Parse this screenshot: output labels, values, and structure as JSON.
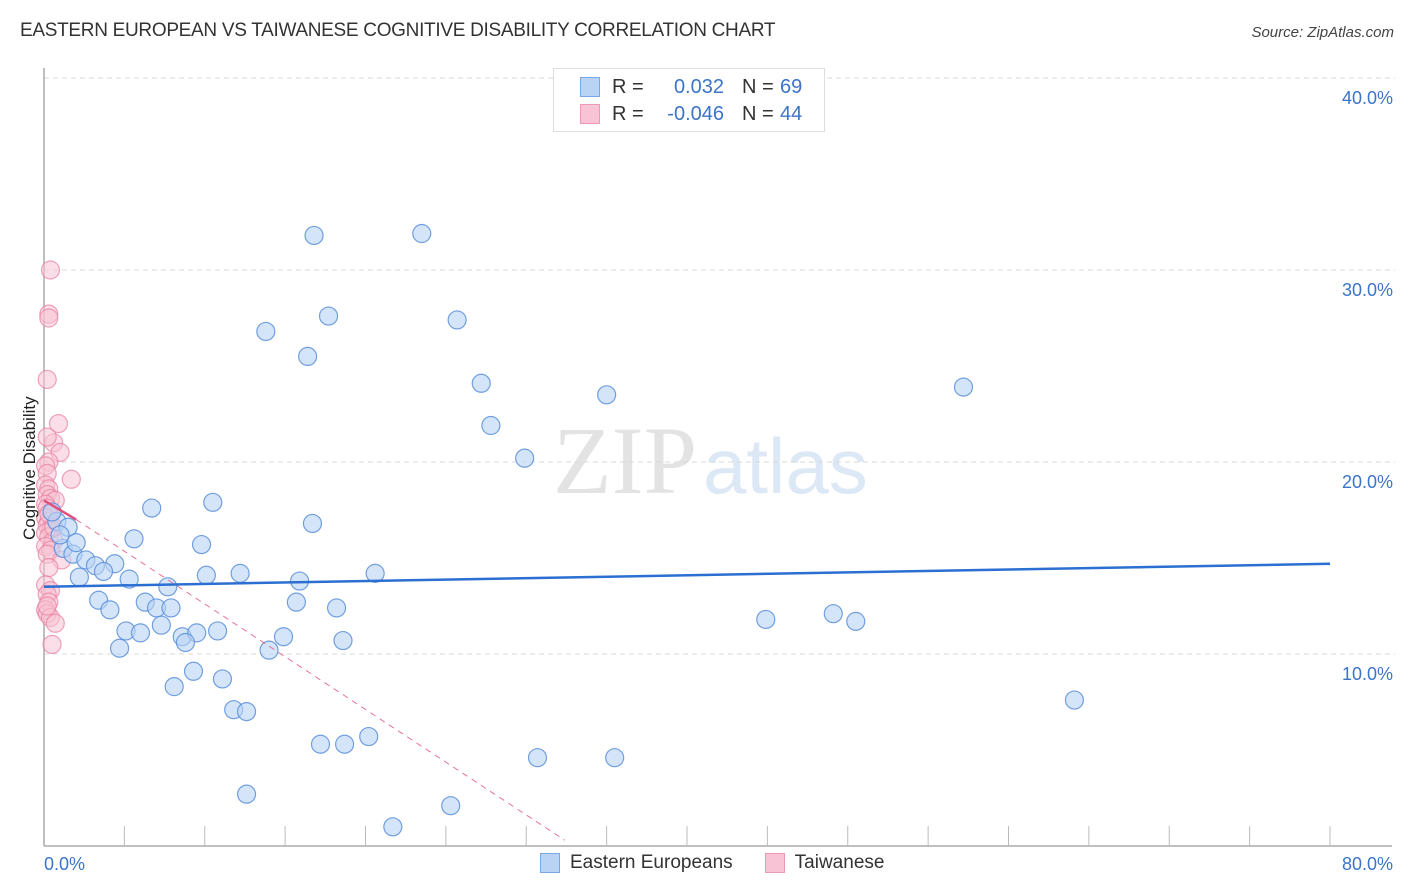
{
  "title": "EASTERN EUROPEAN VS TAIWANESE COGNITIVE DISABILITY CORRELATION CHART",
  "source": "Source: ZipAtlas.com",
  "watermark": {
    "zip": "ZIP",
    "atlas": "atlas"
  },
  "legend_stats": [
    {
      "r_label": "R =",
      "r_value": "0.032",
      "n_label": "N =",
      "n_value": "69"
    },
    {
      "r_label": "R =",
      "r_value": "-0.046",
      "n_label": "N =",
      "n_value": "44"
    }
  ],
  "colors": {
    "blue_fill": "#b9d3f5",
    "blue_stroke": "#5b8fdb",
    "blue_line": "#2a6fd1",
    "pink_fill": "#f8c3d4",
    "pink_stroke": "#e87ea0",
    "pink_line": "#e0507e",
    "axis_text": "#3b74c9"
  },
  "chart_data": {
    "type": "scatter",
    "title": "EASTERN EUROPEAN VS TAIWANESE COGNITIVE DISABILITY CORRELATION CHART",
    "xlabel": "",
    "ylabel": "Cognitive Disability",
    "xlim": [
      0,
      80
    ],
    "ylim": [
      0,
      40
    ],
    "x_tick_labels": [
      "0.0%",
      "80.0%"
    ],
    "y_ticks": [
      10,
      20,
      30,
      40
    ],
    "y_tick_labels": [
      "10.0%",
      "20.0%",
      "30.0%",
      "40.0%"
    ],
    "grid": true,
    "legend": [
      "Eastern Europeans",
      "Taiwanese"
    ],
    "legend_position": "bottom",
    "series": [
      {
        "name": "Eastern Europeans",
        "r": 0.032,
        "n": 69,
        "trend": {
          "x": [
            0,
            80
          ],
          "y": [
            13.5,
            14.7
          ]
        },
        "points": [
          [
            16.8,
            31.8
          ],
          [
            23.5,
            31.9
          ],
          [
            13.8,
            26.8
          ],
          [
            17.7,
            27.6
          ],
          [
            25.7,
            27.4
          ],
          [
            16.4,
            25.5
          ],
          [
            27.2,
            24.1
          ],
          [
            35.0,
            23.5
          ],
          [
            57.2,
            23.9
          ],
          [
            27.8,
            21.9
          ],
          [
            29.9,
            20.2
          ],
          [
            10.5,
            17.9
          ],
          [
            6.7,
            17.6
          ],
          [
            16.7,
            16.8
          ],
          [
            0.8,
            16.9
          ],
          [
            1.5,
            16.6
          ],
          [
            5.6,
            16.0
          ],
          [
            9.8,
            15.7
          ],
          [
            1.2,
            15.5
          ],
          [
            1.8,
            15.2
          ],
          [
            2.6,
            14.9
          ],
          [
            3.2,
            14.6
          ],
          [
            4.4,
            14.7
          ],
          [
            3.7,
            14.3
          ],
          [
            2.2,
            14.0
          ],
          [
            10.1,
            14.1
          ],
          [
            12.2,
            14.2
          ],
          [
            20.6,
            14.2
          ],
          [
            5.3,
            13.9
          ],
          [
            15.9,
            13.8
          ],
          [
            7.7,
            13.5
          ],
          [
            3.4,
            12.8
          ],
          [
            6.3,
            12.7
          ],
          [
            15.7,
            12.7
          ],
          [
            4.1,
            12.3
          ],
          [
            7.0,
            12.4
          ],
          [
            7.9,
            12.4
          ],
          [
            18.2,
            12.4
          ],
          [
            49.1,
            12.1
          ],
          [
            5.1,
            11.2
          ],
          [
            6.0,
            11.1
          ],
          [
            7.3,
            11.5
          ],
          [
            10.8,
            11.2
          ],
          [
            44.9,
            11.8
          ],
          [
            50.5,
            11.7
          ],
          [
            8.6,
            10.9
          ],
          [
            9.5,
            11.1
          ],
          [
            14.9,
            10.9
          ],
          [
            18.6,
            10.7
          ],
          [
            8.8,
            10.6
          ],
          [
            4.7,
            10.3
          ],
          [
            14.0,
            10.2
          ],
          [
            9.3,
            9.1
          ],
          [
            11.1,
            8.7
          ],
          [
            8.1,
            8.3
          ],
          [
            11.8,
            7.1
          ],
          [
            12.6,
            7.0
          ],
          [
            64.1,
            7.6
          ],
          [
            17.2,
            5.3
          ],
          [
            18.7,
            5.3
          ],
          [
            20.2,
            5.7
          ],
          [
            30.7,
            4.6
          ],
          [
            35.5,
            4.6
          ],
          [
            12.6,
            2.7
          ],
          [
            25.3,
            2.1
          ],
          [
            21.7,
            1.0
          ],
          [
            0.5,
            17.4
          ],
          [
            1.0,
            16.2
          ],
          [
            2.0,
            15.8
          ]
        ]
      },
      {
        "name": "Taiwanese",
        "r": -0.046,
        "n": 44,
        "trend_solid": {
          "x": [
            0,
            2.0
          ],
          "y": [
            18.0,
            17.0
          ]
        },
        "trend_dashed": {
          "x": [
            2.0,
            32.4
          ],
          "y": [
            17.0,
            0.3
          ]
        },
        "points": [
          [
            0.4,
            30.0
          ],
          [
            0.3,
            27.7
          ],
          [
            0.3,
            27.5
          ],
          [
            0.2,
            24.3
          ],
          [
            0.9,
            22.0
          ],
          [
            0.6,
            21.0
          ],
          [
            0.2,
            21.3
          ],
          [
            1.0,
            20.5
          ],
          [
            0.3,
            20.0
          ],
          [
            0.1,
            19.8
          ],
          [
            0.2,
            19.4
          ],
          [
            1.7,
            19.1
          ],
          [
            0.1,
            18.8
          ],
          [
            0.3,
            18.6
          ],
          [
            0.2,
            18.3
          ],
          [
            0.4,
            18.1
          ],
          [
            0.7,
            18.0
          ],
          [
            0.1,
            17.8
          ],
          [
            0.2,
            17.6
          ],
          [
            0.5,
            17.4
          ],
          [
            0.1,
            17.1
          ],
          [
            0.3,
            16.9
          ],
          [
            0.2,
            16.7
          ],
          [
            0.4,
            16.5
          ],
          [
            0.1,
            16.3
          ],
          [
            0.3,
            16.1
          ],
          [
            0.6,
            15.9
          ],
          [
            0.1,
            15.6
          ],
          [
            0.4,
            15.4
          ],
          [
            0.2,
            15.2
          ],
          [
            1.1,
            14.9
          ],
          [
            0.3,
            14.5
          ],
          [
            0.1,
            13.6
          ],
          [
            0.4,
            13.3
          ],
          [
            0.2,
            13.1
          ],
          [
            0.3,
            12.7
          ],
          [
            0.1,
            12.3
          ],
          [
            0.2,
            12.1
          ],
          [
            0.4,
            11.9
          ],
          [
            0.7,
            11.6
          ],
          [
            0.5,
            10.5
          ],
          [
            0.2,
            12.5
          ],
          [
            0.3,
            17.3
          ],
          [
            0.6,
            16.6
          ]
        ]
      }
    ]
  }
}
